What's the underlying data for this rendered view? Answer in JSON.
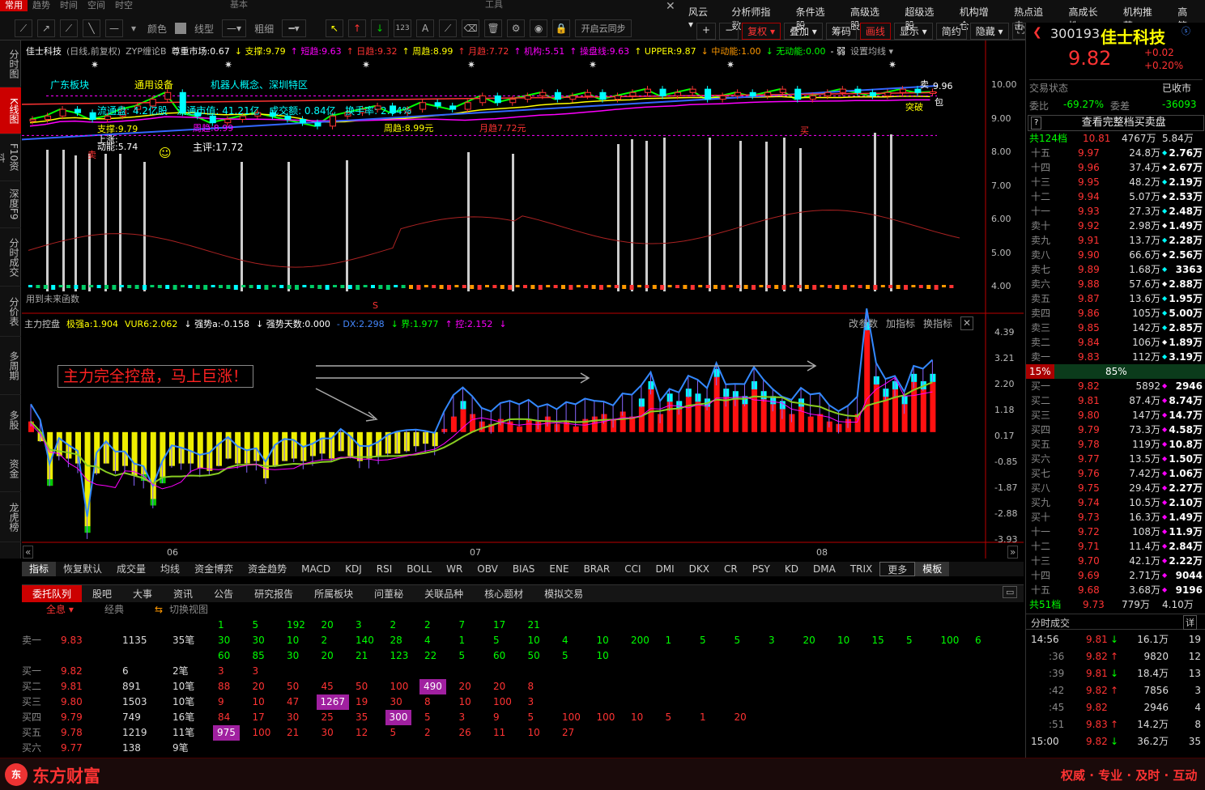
{
  "topbar": {
    "tabs": [
      "常用",
      "趋势",
      "时间",
      "空间",
      "时空"
    ],
    "groups": [
      "基本",
      "工具"
    ],
    "color_label": "颜色",
    "line_label": "线型",
    "width_label": "粗细",
    "cloud_sync": "开启云同步",
    "menu": [
      "风云 ▾",
      "分析师指数",
      "条件选股",
      "高级选股",
      "超级选股",
      "机构增仓",
      "热点追击",
      "高成长性",
      "机构推荐",
      "高管"
    ],
    "controls": [
      "复权 ▾",
      "叠加 ▾",
      "筹码",
      "画线",
      "显示 ▾",
      "简约",
      "隐藏 ▾"
    ]
  },
  "leftnav": [
    "分时图",
    "K线图",
    "F10资料",
    "深度F9",
    "分时成交",
    "分价表",
    "多周期",
    "多股",
    "资金",
    "龙虎榜"
  ],
  "kline": {
    "info_items": [
      {
        "t": "佳士科技",
        "c": "#fff"
      },
      {
        "t": "(日线,前复权)",
        "c": "#aaa"
      },
      {
        "t": "ZYP缠论B",
        "c": "#aaa"
      },
      {
        "t": "尊重市场:0.67",
        "c": "#fff"
      },
      {
        "t": "↓ 支撑:9.79",
        "c": "#ff0"
      },
      {
        "t": "↑ 短趋:9.63",
        "c": "#f0f"
      },
      {
        "t": "↑ 日趋:9.32",
        "c": "#f33"
      },
      {
        "t": "↑ 周趋:8.99",
        "c": "#ff0"
      },
      {
        "t": "↑ 月趋:7.72",
        "c": "#f33"
      },
      {
        "t": "↑ 机构:5.51",
        "c": "#f0f"
      },
      {
        "t": "↑ 操盘线:9.63",
        "c": "#f0f"
      },
      {
        "t": "↑ UPPER:9.87",
        "c": "#ff0"
      },
      {
        "t": "↓ 中动能:1.00",
        "c": "#f90"
      },
      {
        "t": "↓ 无动能:0.00",
        "c": "#0f0"
      },
      {
        "t": "- 弱",
        "c": "#fff"
      },
      {
        "t": "设置均线 ▾",
        "c": "#aaa"
      }
    ],
    "tags": [
      "广东板块",
      "通用设备",
      "机器人概念、深圳特区"
    ],
    "stats": {
      "float_shares": "流通盘: 4.2亿股",
      "float_value": "流通市值: 41.21亿",
      "turnover": "成交额: 0.84亿",
      "rate": "换手率: 2.04%"
    },
    "annotations": {
      "support": "支撑:9.79",
      "rising": "上涨:",
      "energy": "动能:5.74",
      "score": "主评:17.72",
      "week": "周趋:8.99",
      "week2": "周趋:8.99元",
      "month": "月趋7.72元",
      "sell": "卖",
      "sell2": "卖",
      "buy": "买",
      "high": "9.96",
      "break": "突破",
      "upper_tag": "卖",
      "bao": "包",
      "future": "用到未来函数",
      "s": "S"
    },
    "yaxis": [
      "10.00",
      "9.00",
      "8.00",
      "7.00",
      "6.00",
      "5.00",
      "4.00"
    ]
  },
  "sub": {
    "items": [
      {
        "t": "主力控盘",
        "c": "#ccc"
      },
      {
        "t": "极强a:1.904",
        "c": "#ff0"
      },
      {
        "t": "VUR6:2.062",
        "c": "#ff0"
      },
      {
        "t": "↓ 强势a:-0.158",
        "c": "#fff"
      },
      {
        "t": "↓ 强势天数:0.000",
        "c": "#fff"
      },
      {
        "t": "- DX:2.298",
        "c": "#48f"
      },
      {
        "t": "↓ 界:1.977",
        "c": "#0f0"
      },
      {
        "t": "↑ 控:2.152",
        "c": "#f0f"
      },
      {
        "t": "↓",
        "c": "#f0f"
      }
    ],
    "buttons": [
      "改参数",
      "加指标",
      "换指标"
    ],
    "banner": "主力完全控盘，马上巨涨！",
    "yaxis": [
      "4.39",
      "3.21",
      "2.20",
      "1.18",
      "0.17",
      "-0.85",
      "-1.87",
      "-2.88",
      "-3.93"
    ],
    "xaxis": [
      "06",
      "07",
      "08"
    ]
  },
  "indicators": [
    "指标",
    "恢复默认",
    "成交量",
    "均线",
    "资金博弈",
    "资金趋势",
    "MACD",
    "KDJ",
    "RSI",
    "BOLL",
    "WR",
    "OBV",
    "BIAS",
    "ENE",
    "BRAR",
    "CCI",
    "DMI",
    "DKX",
    "CR",
    "PSY",
    "KD",
    "DMA",
    "TRIX",
    "更多",
    "模板"
  ],
  "bottom_tabs": [
    "委托队列",
    "股吧",
    "大事",
    "资讯",
    "公告",
    "研究报告",
    "所属板块",
    "问董秘",
    "关联品种",
    "核心题材",
    "模拟交易"
  ],
  "queue": {
    "filter": "全息 ▾",
    "classic": "经典",
    "switch": "切换视图",
    "top_row": [
      "1",
      "5",
      "192",
      "20",
      "3",
      "2",
      "2",
      "7",
      "17",
      "21"
    ],
    "rows": [
      {
        "label": "卖一",
        "price": "9.83",
        "vol": "1135",
        "cnt": "35笔",
        "lines": [
          [
            "30",
            "30",
            "10",
            "2",
            "140",
            "28",
            "4",
            "1",
            "5",
            "10",
            "4",
            "10",
            "200",
            "1",
            "5",
            "5",
            "3",
            "20",
            "10",
            "15",
            "5",
            "100",
            "6"
          ],
          [
            "60",
            "85",
            "30",
            "20",
            "21",
            "123",
            "22",
            "5",
            "60",
            "50",
            "5",
            "10"
          ]
        ]
      },
      {
        "label": "买一",
        "price": "9.82",
        "vol": "6",
        "cnt": "2笔",
        "lines": [
          [
            "3",
            "3"
          ]
        ]
      },
      {
        "label": "买二",
        "price": "9.81",
        "vol": "891",
        "cnt": "10笔",
        "lines": [
          [
            "88",
            "20",
            "50",
            "45",
            "50",
            "100",
            "490",
            "20",
            "20",
            "8"
          ]
        ],
        "hl": [
          6
        ]
      },
      {
        "label": "买三",
        "price": "9.80",
        "vol": "1503",
        "cnt": "10笔",
        "lines": [
          [
            "9",
            "10",
            "47",
            "1267",
            "19",
            "30",
            "8",
            "10",
            "100",
            "3"
          ]
        ],
        "hl": [
          3
        ]
      },
      {
        "label": "买四",
        "price": "9.79",
        "vol": "749",
        "cnt": "16笔",
        "lines": [
          [
            "84",
            "17",
            "30",
            "25",
            "35",
            "300",
            "5",
            "3",
            "9",
            "5",
            "100",
            "100",
            "10",
            "5",
            "1",
            "20"
          ]
        ],
        "hl": [
          5
        ]
      },
      {
        "label": "买五",
        "price": "9.78",
        "vol": "1219",
        "cnt": "11笔",
        "lines": [
          [
            "975",
            "100",
            "21",
            "30",
            "12",
            "5",
            "2",
            "26",
            "11",
            "10",
            "27"
          ]
        ],
        "hl": [
          0
        ]
      },
      {
        "label": "买六",
        "price": "9.77",
        "vol": "138",
        "cnt": "9笔",
        "lines": [
          []
        ]
      }
    ]
  },
  "quote": {
    "code": "300193",
    "name": "佳士科技",
    "price": "9.82",
    "change": "+0.02",
    "pct": "+0.20%",
    "status_label": "交易状态",
    "status": "已收市",
    "weibi_label": "委比",
    "weibi": "-69.27%",
    "weicha_label": "委差",
    "weicha": "-36093",
    "full_btn": "查看完整档买卖盘",
    "sell_hdr": [
      "共124档",
      "10.81",
      "4767万",
      "5.84万"
    ],
    "buy_hdr": [
      "共51档",
      "9.73",
      "779万",
      "4.10万"
    ],
    "sep": [
      "15%",
      "85%"
    ],
    "asks": [
      [
        "十五",
        "9.97",
        "24.8万",
        "2.76万"
      ],
      [
        "十四",
        "9.96",
        "37.4万",
        "2.67万"
      ],
      [
        "十三",
        "9.95",
        "48.2万",
        "2.19万"
      ],
      [
        "十二",
        "9.94",
        "5.07万",
        "2.53万"
      ],
      [
        "十一",
        "9.93",
        "27.3万",
        "2.48万"
      ],
      [
        "卖十",
        "9.92",
        "2.98万",
        "1.49万"
      ],
      [
        "卖九",
        "9.91",
        "13.7万",
        "2.28万"
      ],
      [
        "卖八",
        "9.90",
        "66.6万",
        "2.56万"
      ],
      [
        "卖七",
        "9.89",
        "1.68万",
        "3363"
      ],
      [
        "卖六",
        "9.88",
        "57.6万",
        "2.88万"
      ],
      [
        "卖五",
        "9.87",
        "13.6万",
        "1.95万"
      ],
      [
        "卖四",
        "9.86",
        "105万",
        "5.00万"
      ],
      [
        "卖三",
        "9.85",
        "142万",
        "2.85万"
      ],
      [
        "卖二",
        "9.84",
        "106万",
        "1.89万"
      ],
      [
        "卖一",
        "9.83",
        "112万",
        "3.19万"
      ]
    ],
    "bids": [
      [
        "买一",
        "9.82",
        "5892",
        "2946"
      ],
      [
        "买二",
        "9.81",
        "87.4万",
        "8.74万"
      ],
      [
        "买三",
        "9.80",
        "147万",
        "14.7万"
      ],
      [
        "买四",
        "9.79",
        "73.3万",
        "4.58万"
      ],
      [
        "买五",
        "9.78",
        "119万",
        "10.8万"
      ],
      [
        "买六",
        "9.77",
        "13.5万",
        "1.50万"
      ],
      [
        "买七",
        "9.76",
        "7.42万",
        "1.06万"
      ],
      [
        "买八",
        "9.75",
        "29.4万",
        "2.27万"
      ],
      [
        "买九",
        "9.74",
        "10.5万",
        "2.10万"
      ],
      [
        "买十",
        "9.73",
        "16.3万",
        "1.49万"
      ],
      [
        "十一",
        "9.72",
        "108万",
        "11.9万"
      ],
      [
        "十二",
        "9.71",
        "11.4万",
        "2.84万"
      ],
      [
        "十三",
        "9.70",
        "42.1万",
        "2.22万"
      ],
      [
        "十四",
        "9.69",
        "2.71万",
        "9044"
      ],
      [
        "十五",
        "9.68",
        "3.68万",
        "9196"
      ]
    ],
    "ticks_title": "分时成交",
    "ticks_detail": "详",
    "ticks": [
      [
        "14:56",
        "9.81",
        "↓",
        "16.1万",
        "19"
      ],
      [
        ":36",
        "9.82",
        "↑",
        "9820",
        "12"
      ],
      [
        ":39",
        "9.81",
        "↓",
        "18.4万",
        "13"
      ],
      [
        ":42",
        "9.82",
        "↑",
        "7856",
        "3"
      ],
      [
        ":45",
        "9.82",
        "",
        "2946",
        "4"
      ],
      [
        ":51",
        "9.83",
        "↑",
        "14.2万",
        "8"
      ],
      [
        "15:00",
        "9.82",
        "↓",
        "36.2万",
        "35"
      ]
    ]
  },
  "footer": {
    "brand": "东方财富",
    "slogan": "权威 · 专业 · 及时 · 互动"
  },
  "chart_data": {
    "type": "line",
    "main_close": [
      9.0,
      9.1,
      9.3,
      9.2,
      9.0,
      9.1,
      9.3,
      9.4,
      9.6,
      9.8,
      9.2,
      9.1,
      8.9,
      9.0,
      9.1,
      9.2,
      9.1,
      9.0,
      8.9,
      8.8,
      9.1,
      9.2,
      9.3,
      9.4,
      9.2,
      9.3,
      9.5,
      9.4,
      9.3,
      9.5,
      9.7,
      9.5,
      9.6,
      9.7,
      9.8,
      9.6,
      9.7,
      9.8,
      9.6,
      9.7,
      9.8,
      9.9,
      9.7,
      9.8,
      9.9,
      9.6,
      9.7,
      9.8,
      9.7,
      9.8,
      9.9,
      9.6,
      9.7,
      9.8,
      9.9,
      9.8,
      9.7,
      9.8,
      9.9,
      9.8,
      9.82
    ],
    "sub_bars": [
      0.6,
      -0.2,
      -2.0,
      -0.8,
      -0.9,
      -1.1,
      -3.9,
      -1.5,
      -1.1,
      -1.4,
      -1.2,
      -1.6,
      -1.8,
      -2.8,
      -1.9,
      -1.2,
      -1.1,
      -1.1,
      -1.3,
      -1.4,
      -1.2,
      -0.9,
      -1.1,
      -1.1,
      -1.0,
      -1.7,
      -1.2,
      -1.0,
      -0.9,
      -1.0,
      -0.8,
      -0.7,
      -0.9,
      -0.6,
      -0.8,
      -1.0,
      -0.9,
      -0.8,
      -0.7,
      -0.7,
      -0.6,
      -0.4,
      -0.3,
      -0.4,
      0.3,
      0.8,
      1.1,
      0.9,
      0.6,
      0.5,
      0.7,
      0.6,
      0.4,
      0.7,
      0.6,
      0.8,
      0.5,
      0.6,
      0.4,
      0.7,
      0.8,
      0.9,
      0.7,
      1.0,
      0.8,
      1.2,
      1.9,
      0.9,
      1.4,
      1.1,
      1.6,
      1.4,
      1.2,
      2.4,
      1.6,
      1.5,
      1.3,
      1.9,
      1.5,
      1.3,
      1.1,
      0.9,
      1.2,
      0.8,
      0.9,
      0.6,
      0.5,
      0.7,
      0.9,
      4.3,
      2.1,
      1.6,
      1.9,
      1.3,
      2.2,
      1.9,
      2.2
    ]
  }
}
